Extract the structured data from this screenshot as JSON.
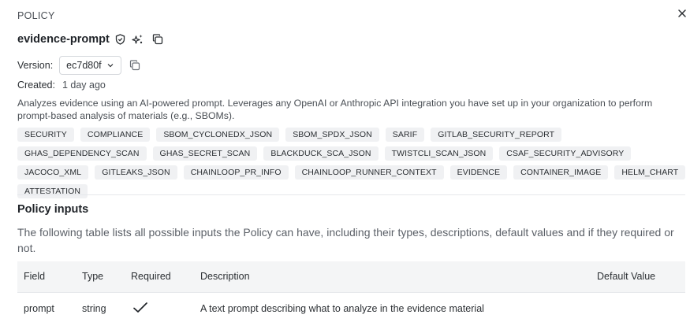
{
  "header": {
    "label": "POLICY"
  },
  "policy": {
    "name": "evidence-prompt",
    "icons": [
      "shield-check-icon",
      "sparkles-icon",
      "copy-icon"
    ]
  },
  "version": {
    "label": "Version:",
    "selected": "ec7d80f"
  },
  "created": {
    "label": "Created:",
    "value": "1 day ago"
  },
  "description": "Analyzes evidence using an AI-powered prompt. Leverages any OpenAI or Anthropic API integration you have set up in your organization to perform prompt-based analysis of materials (e.g., SBOMs).",
  "tags": [
    "SECURITY",
    "COMPLIANCE",
    "SBOM_CYCLONEDX_JSON",
    "SBOM_SPDX_JSON",
    "SARIF",
    "GITLAB_SECURITY_REPORT",
    "GHAS_DEPENDENCY_SCAN",
    "GHAS_SECRET_SCAN",
    "BLACKDUCK_SCA_JSON",
    "TWISTCLI_SCAN_JSON",
    "CSAF_SECURITY_ADVISORY",
    "JACOCO_XML",
    "GITLEAKS_JSON",
    "CHAINLOOP_PR_INFO",
    "CHAINLOOP_RUNNER_CONTEXT",
    "EVIDENCE",
    "CONTAINER_IMAGE",
    "HELM_CHART",
    "ATTESTATION"
  ],
  "inputs": {
    "title": "Policy inputs",
    "description": "The following table lists all possible inputs the Policy can have, including their types, descriptions, default values and if they required or not.",
    "columns": {
      "field": "Field",
      "type": "Type",
      "required": "Required",
      "description": "Description",
      "default": "Default Value"
    },
    "rows": [
      {
        "field": "prompt",
        "type": "string",
        "required": true,
        "description": "A text prompt describing what to analyze in the evidence material",
        "default": ""
      }
    ]
  }
}
